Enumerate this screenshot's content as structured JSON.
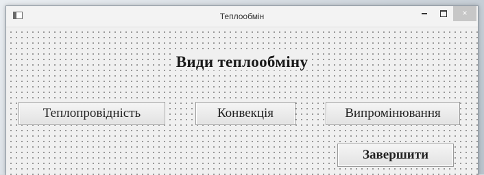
{
  "window": {
    "title": "Теплообмін",
    "controls": {
      "minimize_icon": "minimize-icon",
      "maximize_icon": "maximize-icon",
      "close_icon": "close-icon",
      "close_glyph": "×"
    }
  },
  "form": {
    "heading": "Види теплообміну",
    "buttons": {
      "conduction": "Теплопровідність",
      "convection": "Конвекція",
      "radiation": "Випромінювання",
      "finish": "Завершити"
    }
  }
}
